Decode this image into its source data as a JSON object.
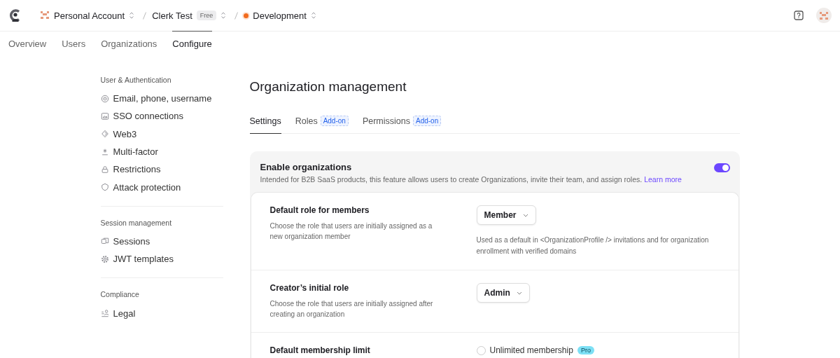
{
  "topbar": {
    "breadcrumbs": [
      {
        "kind": "account",
        "label": "Personal Account"
      },
      {
        "kind": "app",
        "label": "Clerk Test",
        "badge": "Free"
      },
      {
        "kind": "instance",
        "label": "Development",
        "color": "#f26b1d"
      }
    ]
  },
  "nav": {
    "tabs": [
      {
        "label": "Overview",
        "selected": false
      },
      {
        "label": "Users",
        "selected": false
      },
      {
        "label": "Organizations",
        "selected": false
      },
      {
        "label": "Configure",
        "selected": true
      }
    ]
  },
  "sidebar": {
    "sections": [
      {
        "title": "User & Authentication",
        "items": [
          {
            "kind": "fingerprint",
            "label": "Email, phone, username"
          },
          {
            "kind": "sso",
            "label": "SSO connections"
          },
          {
            "kind": "web3",
            "label": "Web3"
          },
          {
            "kind": "asterisk",
            "label": "Multi-factor"
          },
          {
            "kind": "lock",
            "label": "Restrictions"
          },
          {
            "kind": "shield",
            "label": "Attack protection"
          }
        ]
      },
      {
        "title": "Session management",
        "items": [
          {
            "kind": "sessions",
            "label": "Sessions"
          },
          {
            "kind": "gear",
            "label": "JWT templates"
          }
        ]
      },
      {
        "title": "Compliance",
        "items": [
          {
            "kind": "legal",
            "label": "Legal"
          }
        ]
      }
    ]
  },
  "main": {
    "title": "Organization management",
    "tabs": [
      {
        "label": "Settings",
        "selected": true
      },
      {
        "label": "Roles",
        "badge": "Add-on",
        "selected": false
      },
      {
        "label": "Permissions",
        "badge": "Add-on",
        "selected": false
      }
    ],
    "enable": {
      "title": "Enable organizations",
      "description": "Intended for B2B SaaS products, this feature allows users to create Organizations, invite their team, and assign roles.",
      "link": "Learn more",
      "on": true
    },
    "settings": [
      {
        "kind": "select",
        "title": "Default role for members",
        "description": "Choose the role that users are initially assigned as a new organization member",
        "value": "Member",
        "note": "Used as a default in <OrganizationProfile /> invitations and for organization enrollment with verified domains"
      },
      {
        "kind": "select",
        "title": "Creator’s initial role",
        "description": "Choose the role that users are initially assigned after creating an organization",
        "value": "Admin"
      },
      {
        "kind": "radio",
        "title": "Default membership limit",
        "option": {
          "label": "Unlimited membership",
          "badge": "Pro",
          "selected": false
        }
      }
    ]
  }
}
